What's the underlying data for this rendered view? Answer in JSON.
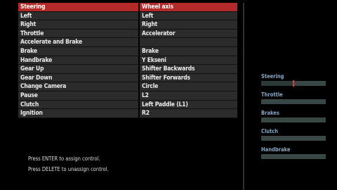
{
  "controls": [
    {
      "action": "Steering",
      "binding": "Wheel axis",
      "selected": true
    },
    {
      "action": "Left",
      "binding": "Left"
    },
    {
      "action": "Right",
      "binding": "Right"
    },
    {
      "action": "Throttle",
      "binding": "Accelerator"
    },
    {
      "action": "Accelerate and Brake",
      "binding": ""
    },
    {
      "action": "Brake",
      "binding": "Brake"
    },
    {
      "action": "Handbrake",
      "binding": "Y Ekseni"
    },
    {
      "action": "Gear Up",
      "binding": "Shifter Backwards"
    },
    {
      "action": "Gear Down",
      "binding": "Shifter Forwards"
    },
    {
      "action": "Change Camera",
      "binding": "Circle"
    },
    {
      "action": "Pause",
      "binding": "L2"
    },
    {
      "action": "Clutch",
      "binding": "Left Paddle (L1)"
    },
    {
      "action": "Ignition",
      "binding": "R2"
    }
  ],
  "instructions": {
    "assign": "Press ENTER to assign control.",
    "unassign": "Press DELETE to unassign control."
  },
  "meters": [
    {
      "label": "Steering",
      "value": 0.5,
      "cursor": true
    },
    {
      "label": "Throttle",
      "value": 0,
      "cursor": false
    },
    {
      "label": "Brakes",
      "value": 0,
      "cursor": false
    },
    {
      "label": "Clutch",
      "value": 0,
      "cursor": false
    },
    {
      "label": "Handbrake",
      "value": 0,
      "cursor": false
    }
  ],
  "colors": {
    "selected_row": "#b42a28",
    "row": "#2b2b2b",
    "meter_label": "#88a8c4",
    "meter_track": "#3a4747",
    "meter_cursor": "#d84040"
  }
}
